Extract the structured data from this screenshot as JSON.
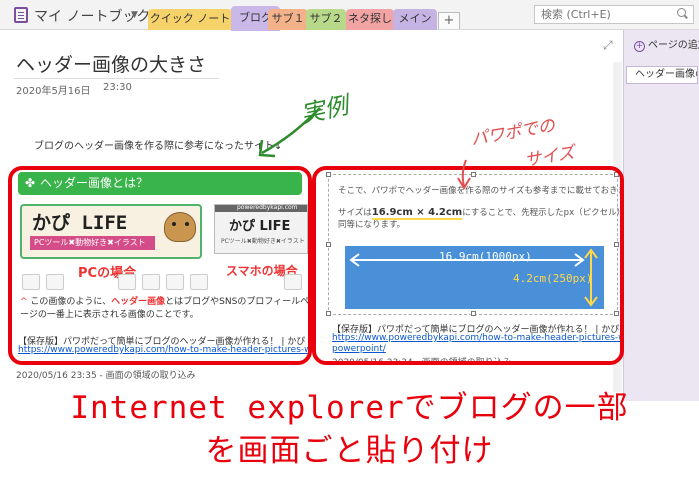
{
  "app": {
    "notebook_title": "マイ ノートブック",
    "search_placeholder": "検索 (Ctrl+E)",
    "tabs": [
      {
        "label": "クイック ノート",
        "color": "#f6d36a",
        "active": false
      },
      {
        "label": "ブログ",
        "color": "#c9b8e8",
        "active": true
      },
      {
        "label": "サブ１",
        "color": "#f3b28a",
        "active": false
      },
      {
        "label": "サブ２",
        "color": "#b9d98a",
        "active": false
      },
      {
        "label": "ネタ探し",
        "color": "#f2a3a3",
        "active": false
      },
      {
        "label": "メイン",
        "color": "#c5b4e3",
        "active": false
      }
    ],
    "add_tab_label": "+"
  },
  "right_panel": {
    "add_page_label": "ページの追加",
    "pages": [
      {
        "label": "ヘッダー画像の"
      }
    ]
  },
  "page": {
    "title": "ヘッダー画像の大きさ",
    "date": "2020年5月16日",
    "time": "23:30",
    "note": "ブログのヘッダー画像を作る際に参考になったサイト↓",
    "handwritten_left": "実例",
    "handwritten_right_line1": "パワポでの",
    "handwritten_right_line2": "サイズ"
  },
  "left_clip": {
    "heading": "ヘッダー画像とは？",
    "pc_logo": "かぴ LIFE",
    "pc_subtitle": "PCツール✖動物好き✖イラスト",
    "sp_url": "poweredbykapi.com",
    "sp_logo": "かぴ LIFE",
    "sp_subtitle": "PCツール✖動物好き✖イラスト",
    "pc_case": "PCの場合",
    "sp_case": "スマホの場合",
    "desc_pre": "この画像のように、",
    "desc_bold": "ヘッダー画像",
    "desc_post": "とはブログやSNSのプロフィールページの一番上に表示される画像のことです。",
    "source": "【保存版】パワポだって簡単にブログのヘッダー画像が作れる！ | かぴ LIFE",
    "link": "https://www.poweredbykapi.com/how-to-make-header-pictures-with-",
    "clip_date": "2020/05/16 23:35 - 画面の領域の取り込み"
  },
  "right_clip": {
    "text1": "そこで、パワポでヘッダー画像を作る際のサイズも参考までに載せておきます。",
    "text2_pre": "サイズは",
    "text2_bold": "16.9cm × 4.2cm",
    "text2_post": "にすることで、先程示したpx（ピクセル）のサイズと",
    "text3": "同等になります。",
    "dim_width": "16.9cm(1000px)",
    "dim_height": "4.2cm(250px)",
    "source": "【保存版】パワポだって簡単にブログのヘッダー画像が作れる！ | かぴ LIFE",
    "link1": "https://www.poweredbykapi.com/how-to-make-header-pictures-with-",
    "link2": "powerpoint/",
    "clip_date": "2020/05/16 23:34 - 画面の領域の取り込み"
  },
  "caption": {
    "line1": "Internet explorerでブログの一部",
    "line2": "を画面ごと貼り付け"
  },
  "colors": {
    "highlight_red": "#e8000d",
    "onenote_purple": "#7a4f9e",
    "handwriting_green": "#2e8b2e",
    "handwriting_red": "#e05050"
  }
}
